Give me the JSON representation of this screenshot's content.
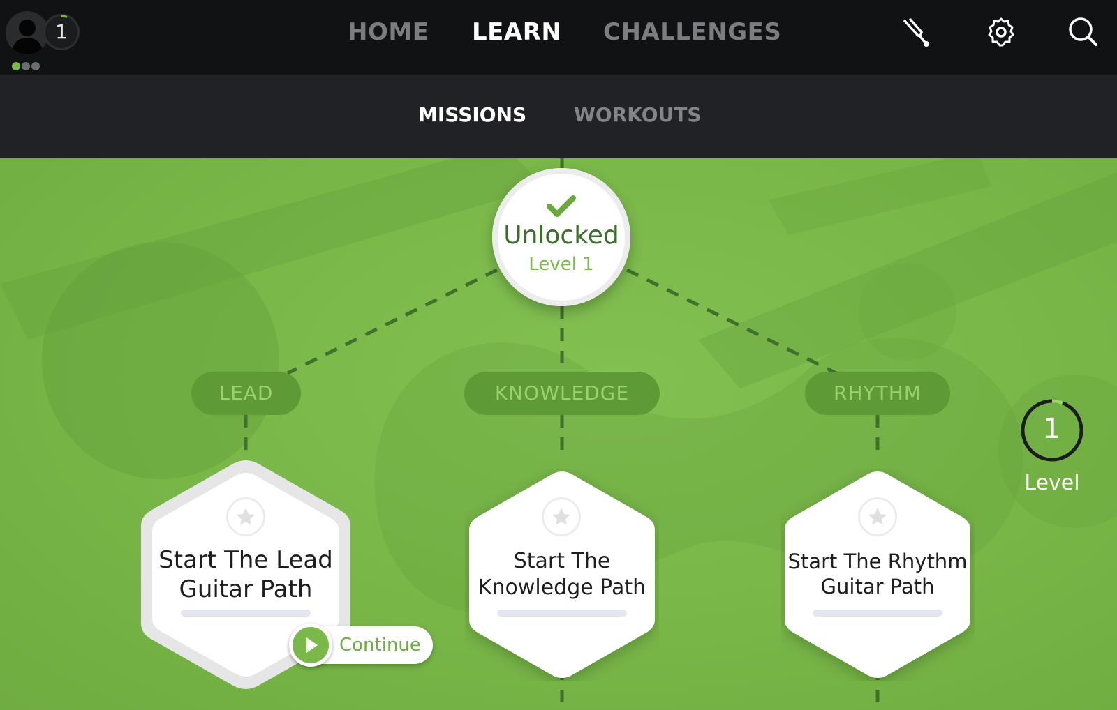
{
  "header": {
    "player_level": "1",
    "nav": [
      {
        "label": "HOME",
        "active": false
      },
      {
        "label": "LEARN",
        "active": true
      },
      {
        "label": "CHALLENGES",
        "active": false
      }
    ],
    "icons": [
      "tuner-icon",
      "gear-icon",
      "search-icon"
    ]
  },
  "subnav": [
    {
      "label": "MISSIONS",
      "active": true
    },
    {
      "label": "WORKOUTS",
      "active": false
    }
  ],
  "root_node": {
    "status": "Unlocked",
    "level": "Level 1"
  },
  "paths": [
    {
      "category": "LEAD",
      "title_line1": "Start The Lead",
      "title_line2": "Guitar Path"
    },
    {
      "category": "KNOWLEDGE",
      "title_line1": "Start The",
      "title_line2": "Knowledge Path"
    },
    {
      "category": "RHYTHM",
      "title_line1": "Start The Rhythm",
      "title_line2": "Guitar Path"
    }
  ],
  "continue_label": "Continue",
  "level_indicator": {
    "value": "1",
    "label": "Level"
  },
  "colors": {
    "accent": "#7ab84a",
    "dark_green": "#3d6e2b",
    "topbar": "#101214",
    "subbar": "#202225"
  }
}
